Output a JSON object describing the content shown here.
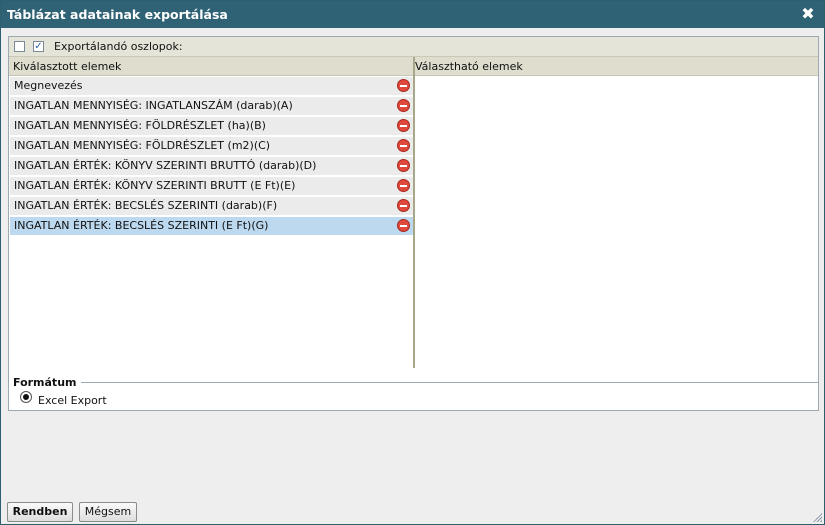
{
  "dialog": {
    "title": "Táblázat adatainak exportálása",
    "close_icon": "close-icon"
  },
  "toolbar": {
    "label": "Exportálandó oszlopok:",
    "checkbox_all_checked": false,
    "checkbox_second_glyph": "✓"
  },
  "columns": {
    "selected_header": "Kiválasztott elemek",
    "available_header": "Választható elemek"
  },
  "selected_items": [
    "Megnevezés",
    "INGATLAN MENNYISÉG: INGATLANSZÁM (darab)(A)",
    "INGATLAN MENNYISÉG: FÖLDRÉSZLET (ha)(B)",
    "INGATLAN MENNYISÉG: FÖLDRÉSZLET (m2)(C)",
    "INGATLAN ÉRTÉK: KÖNYV SZERINTI BRUTTÓ (darab)(D)",
    "INGATLAN ÉRTÉK: KÖNYV SZERINTI BRUTT (E Ft)(E)",
    "INGATLAN ÉRTÉK: BECSLÉS SZERINTI (darab)(F)",
    "INGATLAN ÉRTÉK: BECSLÉS SZERINTI (E Ft)(G)"
  ],
  "selected_index": 7,
  "format": {
    "legend": "Formátum",
    "option": "Excel Export"
  },
  "buttons": {
    "ok": "Rendben",
    "cancel": "Mégsem"
  }
}
